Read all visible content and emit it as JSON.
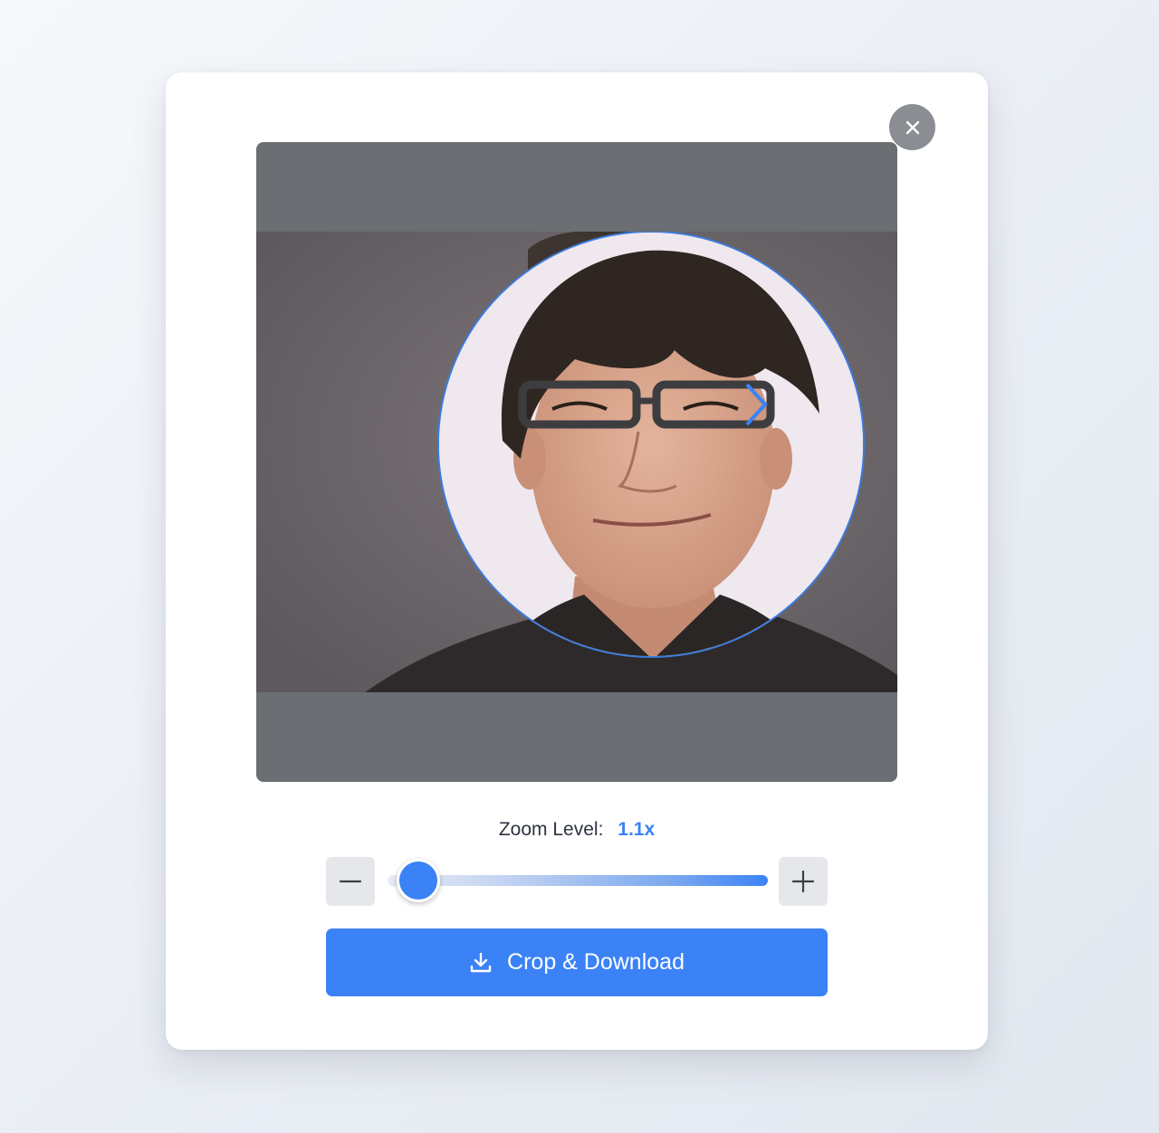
{
  "dialog": {
    "close_icon": "close-icon",
    "crop": {
      "shape": "circle",
      "accent": "#3b7de0",
      "overlay_color": "#6b6e72"
    },
    "zoom": {
      "label": "Zoom Level:",
      "value_text": "1.1x",
      "value": 1.1,
      "slider_fraction": 0.08,
      "decrease_icon": "minus-icon",
      "increase_icon": "plus-icon"
    },
    "action": {
      "label": "Crop & Download",
      "icon": "download-icon"
    },
    "colors": {
      "primary": "#3b82f6",
      "close_bg": "#8a8d92",
      "stepper_bg": "#e5e7eb"
    }
  }
}
